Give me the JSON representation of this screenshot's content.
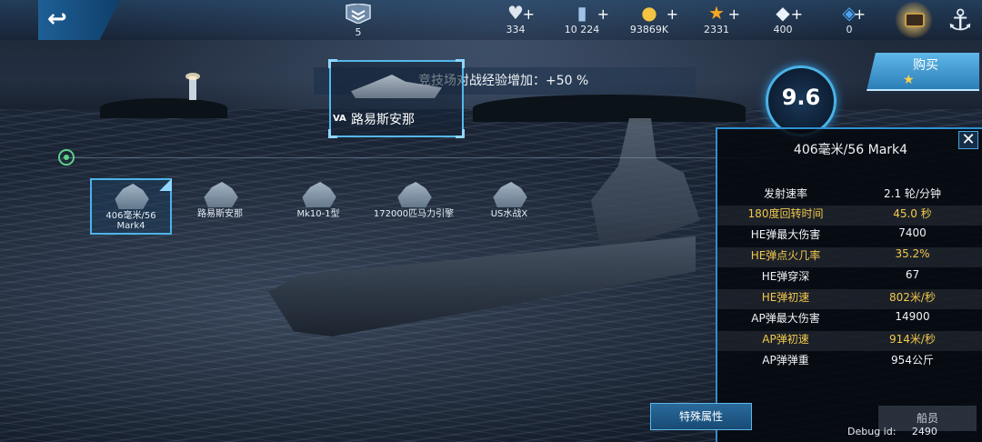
{
  "topbar": {
    "rank": "5",
    "resources": [
      {
        "icon": "heart-icon",
        "value": "334"
      },
      {
        "icon": "card-icon",
        "value": "10 224"
      },
      {
        "icon": "coin-icon",
        "value": "93869K"
      },
      {
        "icon": "star-icon",
        "value": "2331"
      },
      {
        "icon": "diamond-icon",
        "value": "400"
      },
      {
        "icon": "crystal-icon",
        "value": "0"
      }
    ]
  },
  "banner": {
    "text": "竞技场对战经验增加：+50 %"
  },
  "ship": {
    "tag": "VA",
    "name": "路易斯安那",
    "level": "9.6"
  },
  "buy": {
    "label": "购买"
  },
  "modules": [
    {
      "label": "406毫米/56 Mark4"
    },
    {
      "label": "路易斯安那"
    },
    {
      "label": "Mk10-1型"
    },
    {
      "label": "172000匹马力引擎"
    },
    {
      "label": "US水战X"
    }
  ],
  "panel": {
    "title": "406毫米/56 Mark4",
    "close": "✕",
    "stats": [
      {
        "key": "发射速率",
        "value": "2.1 轮/分钟"
      },
      {
        "key": "180度回转时间",
        "value": "45.0 秒"
      },
      {
        "key": "HE弹最大伤害",
        "value": "7400"
      },
      {
        "key": "HE弹点火几率",
        "value": "35.2%"
      },
      {
        "key": "HE弹穿深",
        "value": "67"
      },
      {
        "key": "HE弹初速",
        "value": "802米/秒"
      },
      {
        "key": "AP弹最大伤害",
        "value": "14900"
      },
      {
        "key": "AP弹初速",
        "value": "914米/秒"
      },
      {
        "key": "AP弹弹重",
        "value": "954公斤"
      }
    ]
  },
  "special_button": "特殊属性",
  "crew_button": "船员",
  "debug": {
    "label": "Debug id:",
    "value": "2490"
  }
}
